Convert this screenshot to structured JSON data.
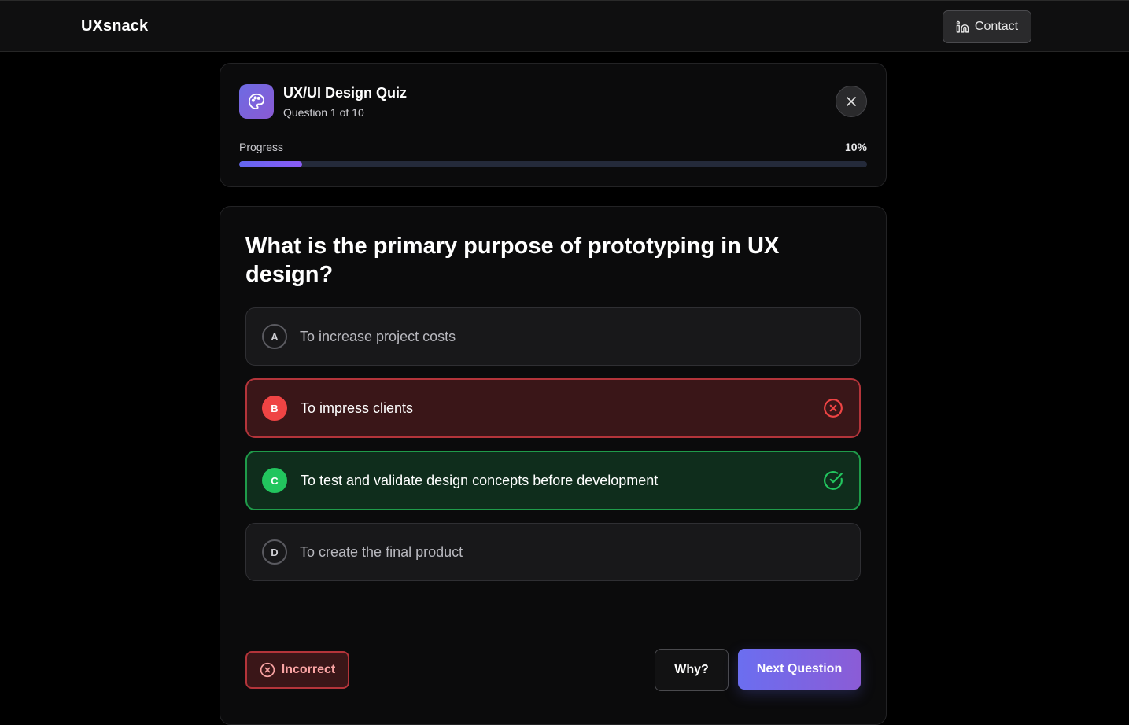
{
  "brand": "UXsnack",
  "nav": {
    "contact_label": "Contact",
    "contact_icon": "linkedin-icon"
  },
  "quiz": {
    "title": "UX/UI Design Quiz",
    "subtitle": "Question 1 of 10",
    "icon": "palette-icon",
    "progress_label": "Progress",
    "progress_text": "10%",
    "progress_value": 0.1
  },
  "question": {
    "text": "What is the primary purpose of prototyping in UX design?",
    "options": [
      {
        "letter": "A",
        "text": "To increase project costs",
        "state": "neutral"
      },
      {
        "letter": "B",
        "text": "To impress clients",
        "state": "incorrect"
      },
      {
        "letter": "C",
        "text": "To test and validate design concepts before development",
        "state": "correct"
      },
      {
        "letter": "D",
        "text": "To create the final product",
        "state": "neutral"
      }
    ]
  },
  "footer": {
    "status_label": "Incorrect",
    "why_label": "Why?",
    "next_label": "Next Question"
  },
  "colors": {
    "accent": "#6366f1",
    "incorrect": "#ef4444",
    "correct": "#22c55e"
  }
}
